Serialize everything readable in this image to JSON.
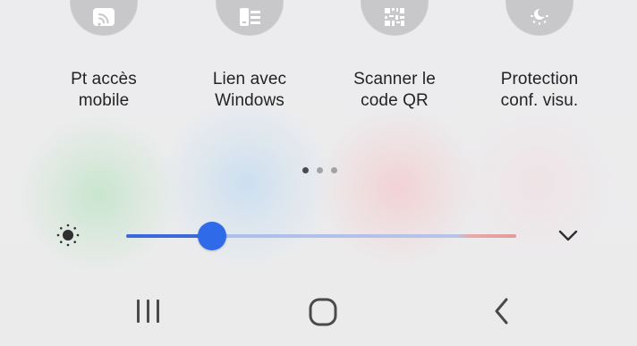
{
  "quick_settings": {
    "tiles": [
      {
        "name": "hotspot",
        "icon": "hotspot-icon",
        "line1": "Pt accès",
        "line2": "mobile"
      },
      {
        "name": "link-to-windows",
        "icon": "link-to-windows-icon",
        "line1": "Lien avec",
        "line2": "Windows"
      },
      {
        "name": "scan-qr",
        "icon": "qr-code-icon",
        "line1": "Scanner le",
        "line2": "code QR"
      },
      {
        "name": "eye-comfort",
        "icon": "eye-comfort-icon",
        "line1": "Protection",
        "line2": "conf. visu."
      }
    ],
    "page_indicator": {
      "current_page": 1,
      "total_pages": 3
    }
  },
  "brightness": {
    "icon": "brightness-icon",
    "level_fraction": 0.22,
    "expand_icon": "chevron-down-icon"
  },
  "navigation_bar": {
    "recent_apps_icon": "recent-apps-icon",
    "home_icon": "home-icon",
    "back_icon": "back-icon"
  },
  "colors": {
    "background": "#ececee",
    "tile_icon_background": "#c8c8cb",
    "slider_active": "#3b69db",
    "slider_thumb": "#2f6ae8",
    "slider_inactive": "#b7c3ea",
    "slider_warm_end": "#e59999"
  }
}
